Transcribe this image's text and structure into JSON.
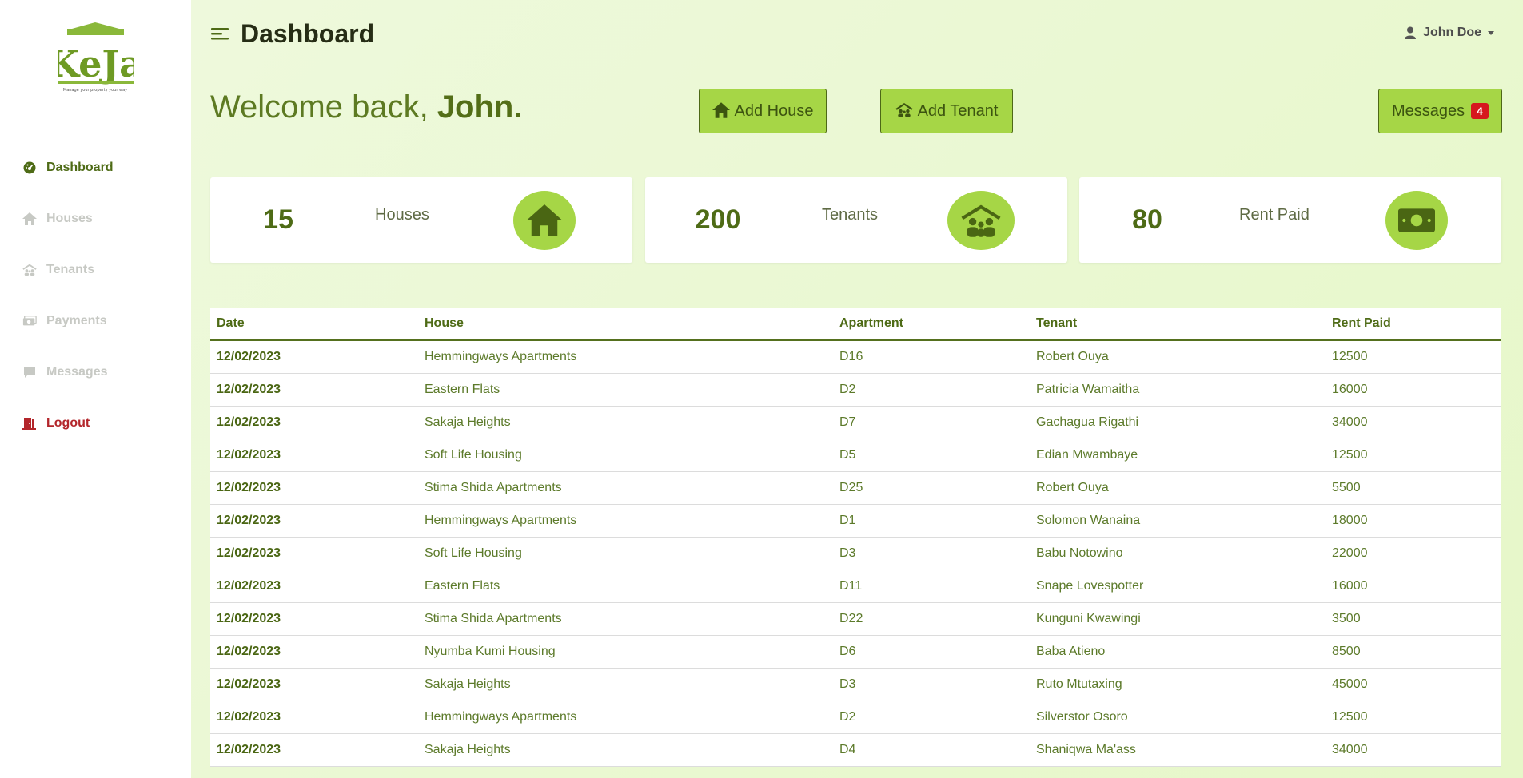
{
  "brand": {
    "logo_text": "KeJa",
    "tagline": "Manage your property your way"
  },
  "sidebar": {
    "items": [
      {
        "label": "Dashboard",
        "icon": "dashboard-icon"
      },
      {
        "label": "Houses",
        "icon": "house-icon"
      },
      {
        "label": "Tenants",
        "icon": "tenants-icon"
      },
      {
        "label": "Payments",
        "icon": "money-icon"
      },
      {
        "label": "Messages",
        "icon": "chat-icon"
      },
      {
        "label": "Logout",
        "icon": "door-icon"
      }
    ],
    "active": "Dashboard"
  },
  "header": {
    "title": "Dashboard",
    "user_name": "John Doe"
  },
  "welcome": {
    "prefix": "Welcome back, ",
    "name": "John."
  },
  "actions": {
    "add_house": "Add House",
    "add_tenant": "Add Tenant",
    "messages": "Messages",
    "messages_count": "4"
  },
  "stats": [
    {
      "value": "15",
      "label": "Houses",
      "icon": "house-icon"
    },
    {
      "value": "200",
      "label": "Tenants",
      "icon": "tenants-icon"
    },
    {
      "value": "80",
      "label": "Rent Paid",
      "icon": "money-icon"
    }
  ],
  "table": {
    "columns": [
      "Date",
      "House",
      "Apartment",
      "Tenant",
      "Rent Paid"
    ],
    "rows": [
      [
        "12/02/2023",
        "Hemmingways Apartments",
        "D16",
        "Robert Ouya",
        "12500"
      ],
      [
        "12/02/2023",
        "Eastern Flats",
        "D2",
        "Patricia Wamaitha",
        "16000"
      ],
      [
        "12/02/2023",
        "Sakaja Heights",
        "D7",
        "Gachagua Rigathi",
        "34000"
      ],
      [
        "12/02/2023",
        "Soft Life Housing",
        "D5",
        "Edian Mwambaye",
        "12500"
      ],
      [
        "12/02/2023",
        "Stima Shida Apartments",
        "D25",
        "Robert Ouya",
        "5500"
      ],
      [
        "12/02/2023",
        "Hemmingways Apartments",
        "D1",
        "Solomon Wanaina",
        "18000"
      ],
      [
        "12/02/2023",
        "Soft Life Housing",
        "D3",
        "Babu Notowino",
        "22000"
      ],
      [
        "12/02/2023",
        "Eastern Flats",
        "D11",
        "Snape Lovespotter",
        "16000"
      ],
      [
        "12/02/2023",
        "Stima Shida Apartments",
        "D22",
        "Kunguni Kwawingi",
        "3500"
      ],
      [
        "12/02/2023",
        "Nyumba Kumi Housing",
        "D6",
        "Baba Atieno",
        "8500"
      ],
      [
        "12/02/2023",
        "Sakaja Heights",
        "D3",
        "Ruto Mtutaxing",
        "45000"
      ],
      [
        "12/02/2023",
        "Hemmingways Apartments",
        "D2",
        "Silverstor Osoro",
        "12500"
      ],
      [
        "12/02/2023",
        "Sakaja Heights",
        "D4",
        "Shaniqwa Ma'ass",
        "34000"
      ]
    ]
  },
  "colors": {
    "accent": "#a6d646",
    "primary": "#4e6b16",
    "danger": "#d6171e",
    "background": "#e9f7d2"
  }
}
